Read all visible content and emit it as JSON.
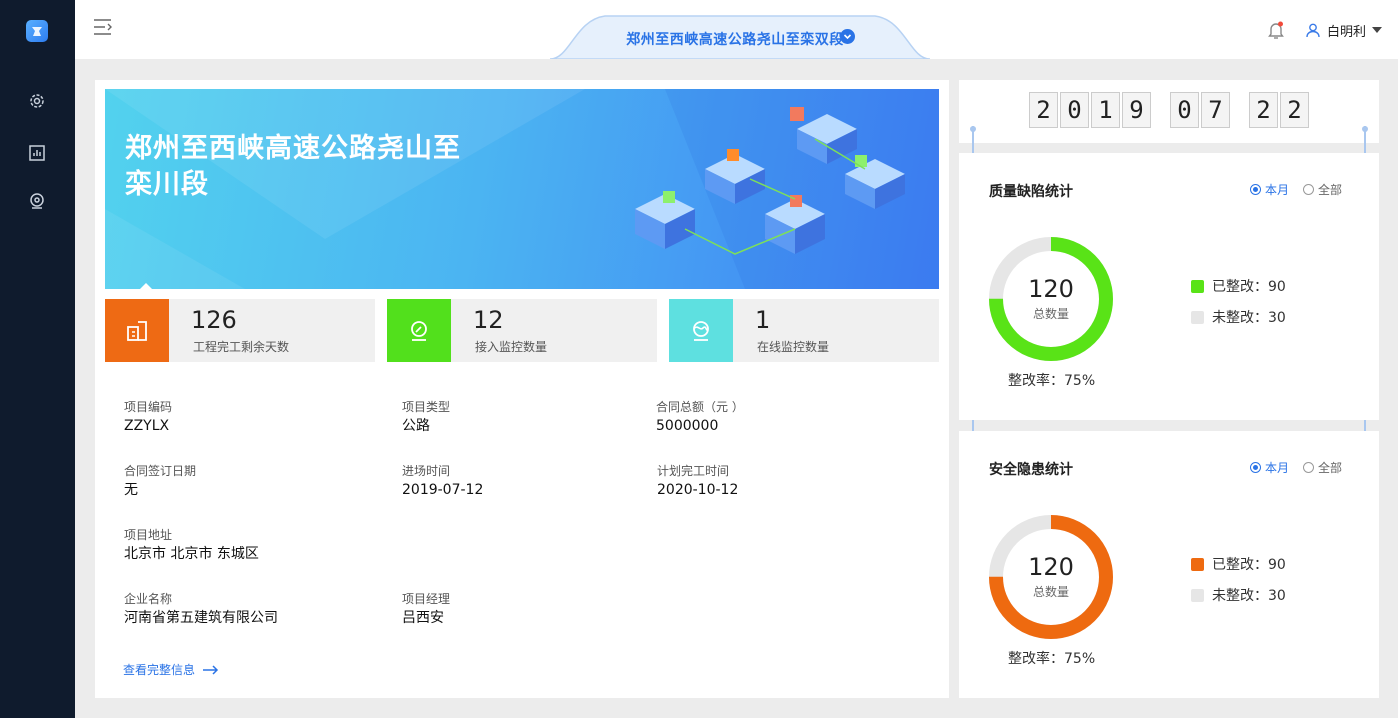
{
  "header": {
    "project_selector": "郑州至西峡高速公路尧山至栾双段",
    "user_name": "白明利"
  },
  "banner": {
    "title": "郑州至西峡高速公路尧山至栾川段"
  },
  "stats": [
    {
      "value": "126",
      "label": "工程完工剩余天数",
      "color": "#ee6a14"
    },
    {
      "value": "12",
      "label": "接入监控数量",
      "color": "#52e01c"
    },
    {
      "value": "1",
      "label": "在线监控数量",
      "color": "#5ee0e0"
    }
  ],
  "fields": {
    "code_label": "项目编码",
    "code": "ZZYLX",
    "type_label": "项目类型",
    "type": "公路",
    "amount_label": "合同总额（元 ）",
    "amount": "5000000",
    "sign_label": "合同签订日期",
    "sign": "无",
    "entry_label": "进场时间",
    "entry": "2019-07-12",
    "finish_label": "计划完工时间",
    "finish": "2020-10-12",
    "address_label": "项目地址",
    "address": "北京市 北京市 东城区",
    "company_label": "企业名称",
    "company": "河南省第五建筑有限公司",
    "manager_label": "项目经理",
    "manager": "吕西安"
  },
  "more_link": "查看完整信息",
  "date": {
    "year": [
      "2",
      "0",
      "1",
      "9"
    ],
    "month": [
      "0",
      "7"
    ],
    "day": [
      "2",
      "2"
    ]
  },
  "quality": {
    "title": "质量缺陷统计",
    "radio_month": "本月",
    "radio_all": "全部",
    "total": "120",
    "total_label": "总数量",
    "fixed_label": "已整改：90",
    "unfixed_label": "未整改：30",
    "rate": "整改率：75%",
    "fixed_fraction": 0.75,
    "color": "#59e317"
  },
  "safety": {
    "title": "安全隐患统计",
    "radio_month": "本月",
    "radio_all": "全部",
    "total": "120",
    "total_label": "总数量",
    "fixed_label": "已整改：90",
    "unfixed_label": "未整改：30",
    "rate": "整改率：75%",
    "fixed_fraction": 0.75,
    "color": "#ee6a10"
  }
}
